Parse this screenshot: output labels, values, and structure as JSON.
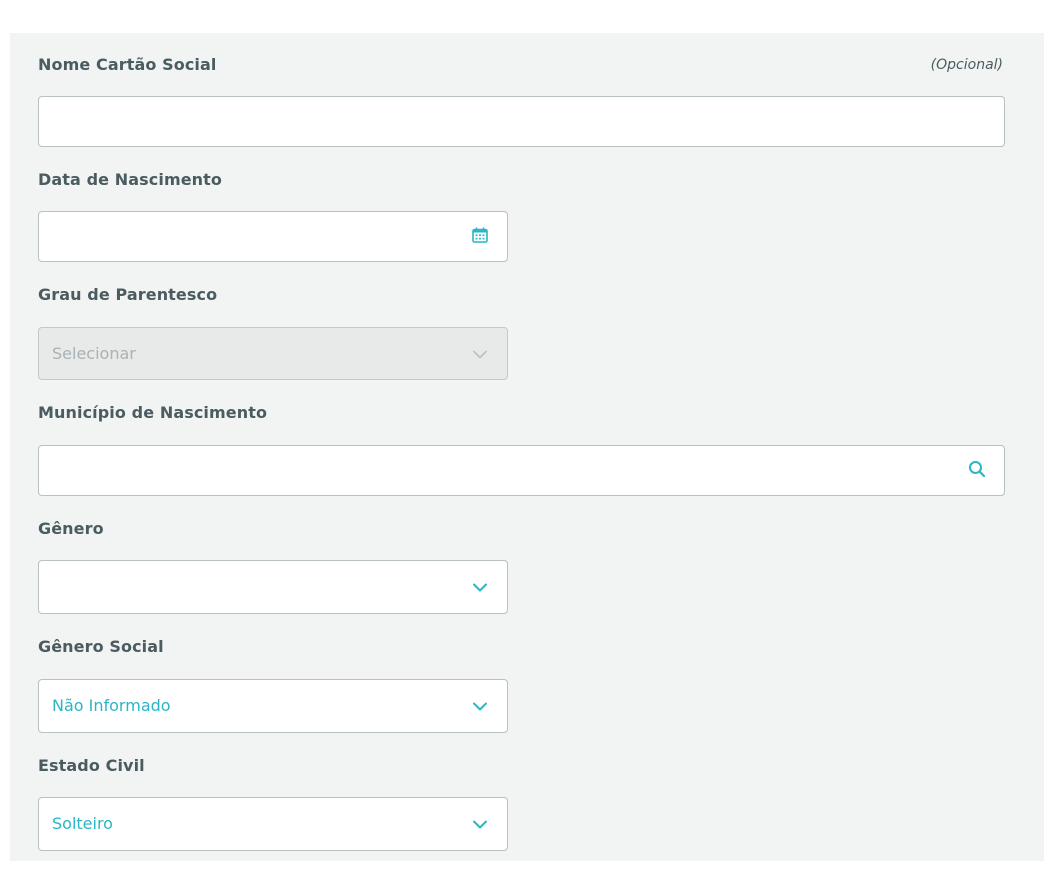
{
  "form": {
    "nome_cartao_social": {
      "label": "Nome Cartão Social",
      "optional": "(Opcional)",
      "value": ""
    },
    "data_nascimento": {
      "label": "Data de Nascimento",
      "value": "",
      "icon": "calendar-icon"
    },
    "grau_parentesco": {
      "label": "Grau de Parentesco",
      "value": "Selecionar",
      "disabled": true,
      "icon": "chevron-down-icon"
    },
    "municipio_nascimento": {
      "label": "Município de Nascimento",
      "value": "",
      "icon": "search-icon"
    },
    "genero": {
      "label": "Gênero",
      "value": "",
      "icon": "chevron-down-icon"
    },
    "genero_social": {
      "label": "Gênero Social",
      "value": "Não Informado",
      "icon": "chevron-down-icon"
    },
    "estado_civil": {
      "label": "Estado Civil",
      "value": "Solteiro",
      "icon": "chevron-down-icon"
    }
  },
  "colors": {
    "label": "#4a5c60",
    "accent": "#29b6c5",
    "panel": "#f2f3f3",
    "border": "#b8c0c2",
    "disabled_text": "#a9b2b4"
  }
}
